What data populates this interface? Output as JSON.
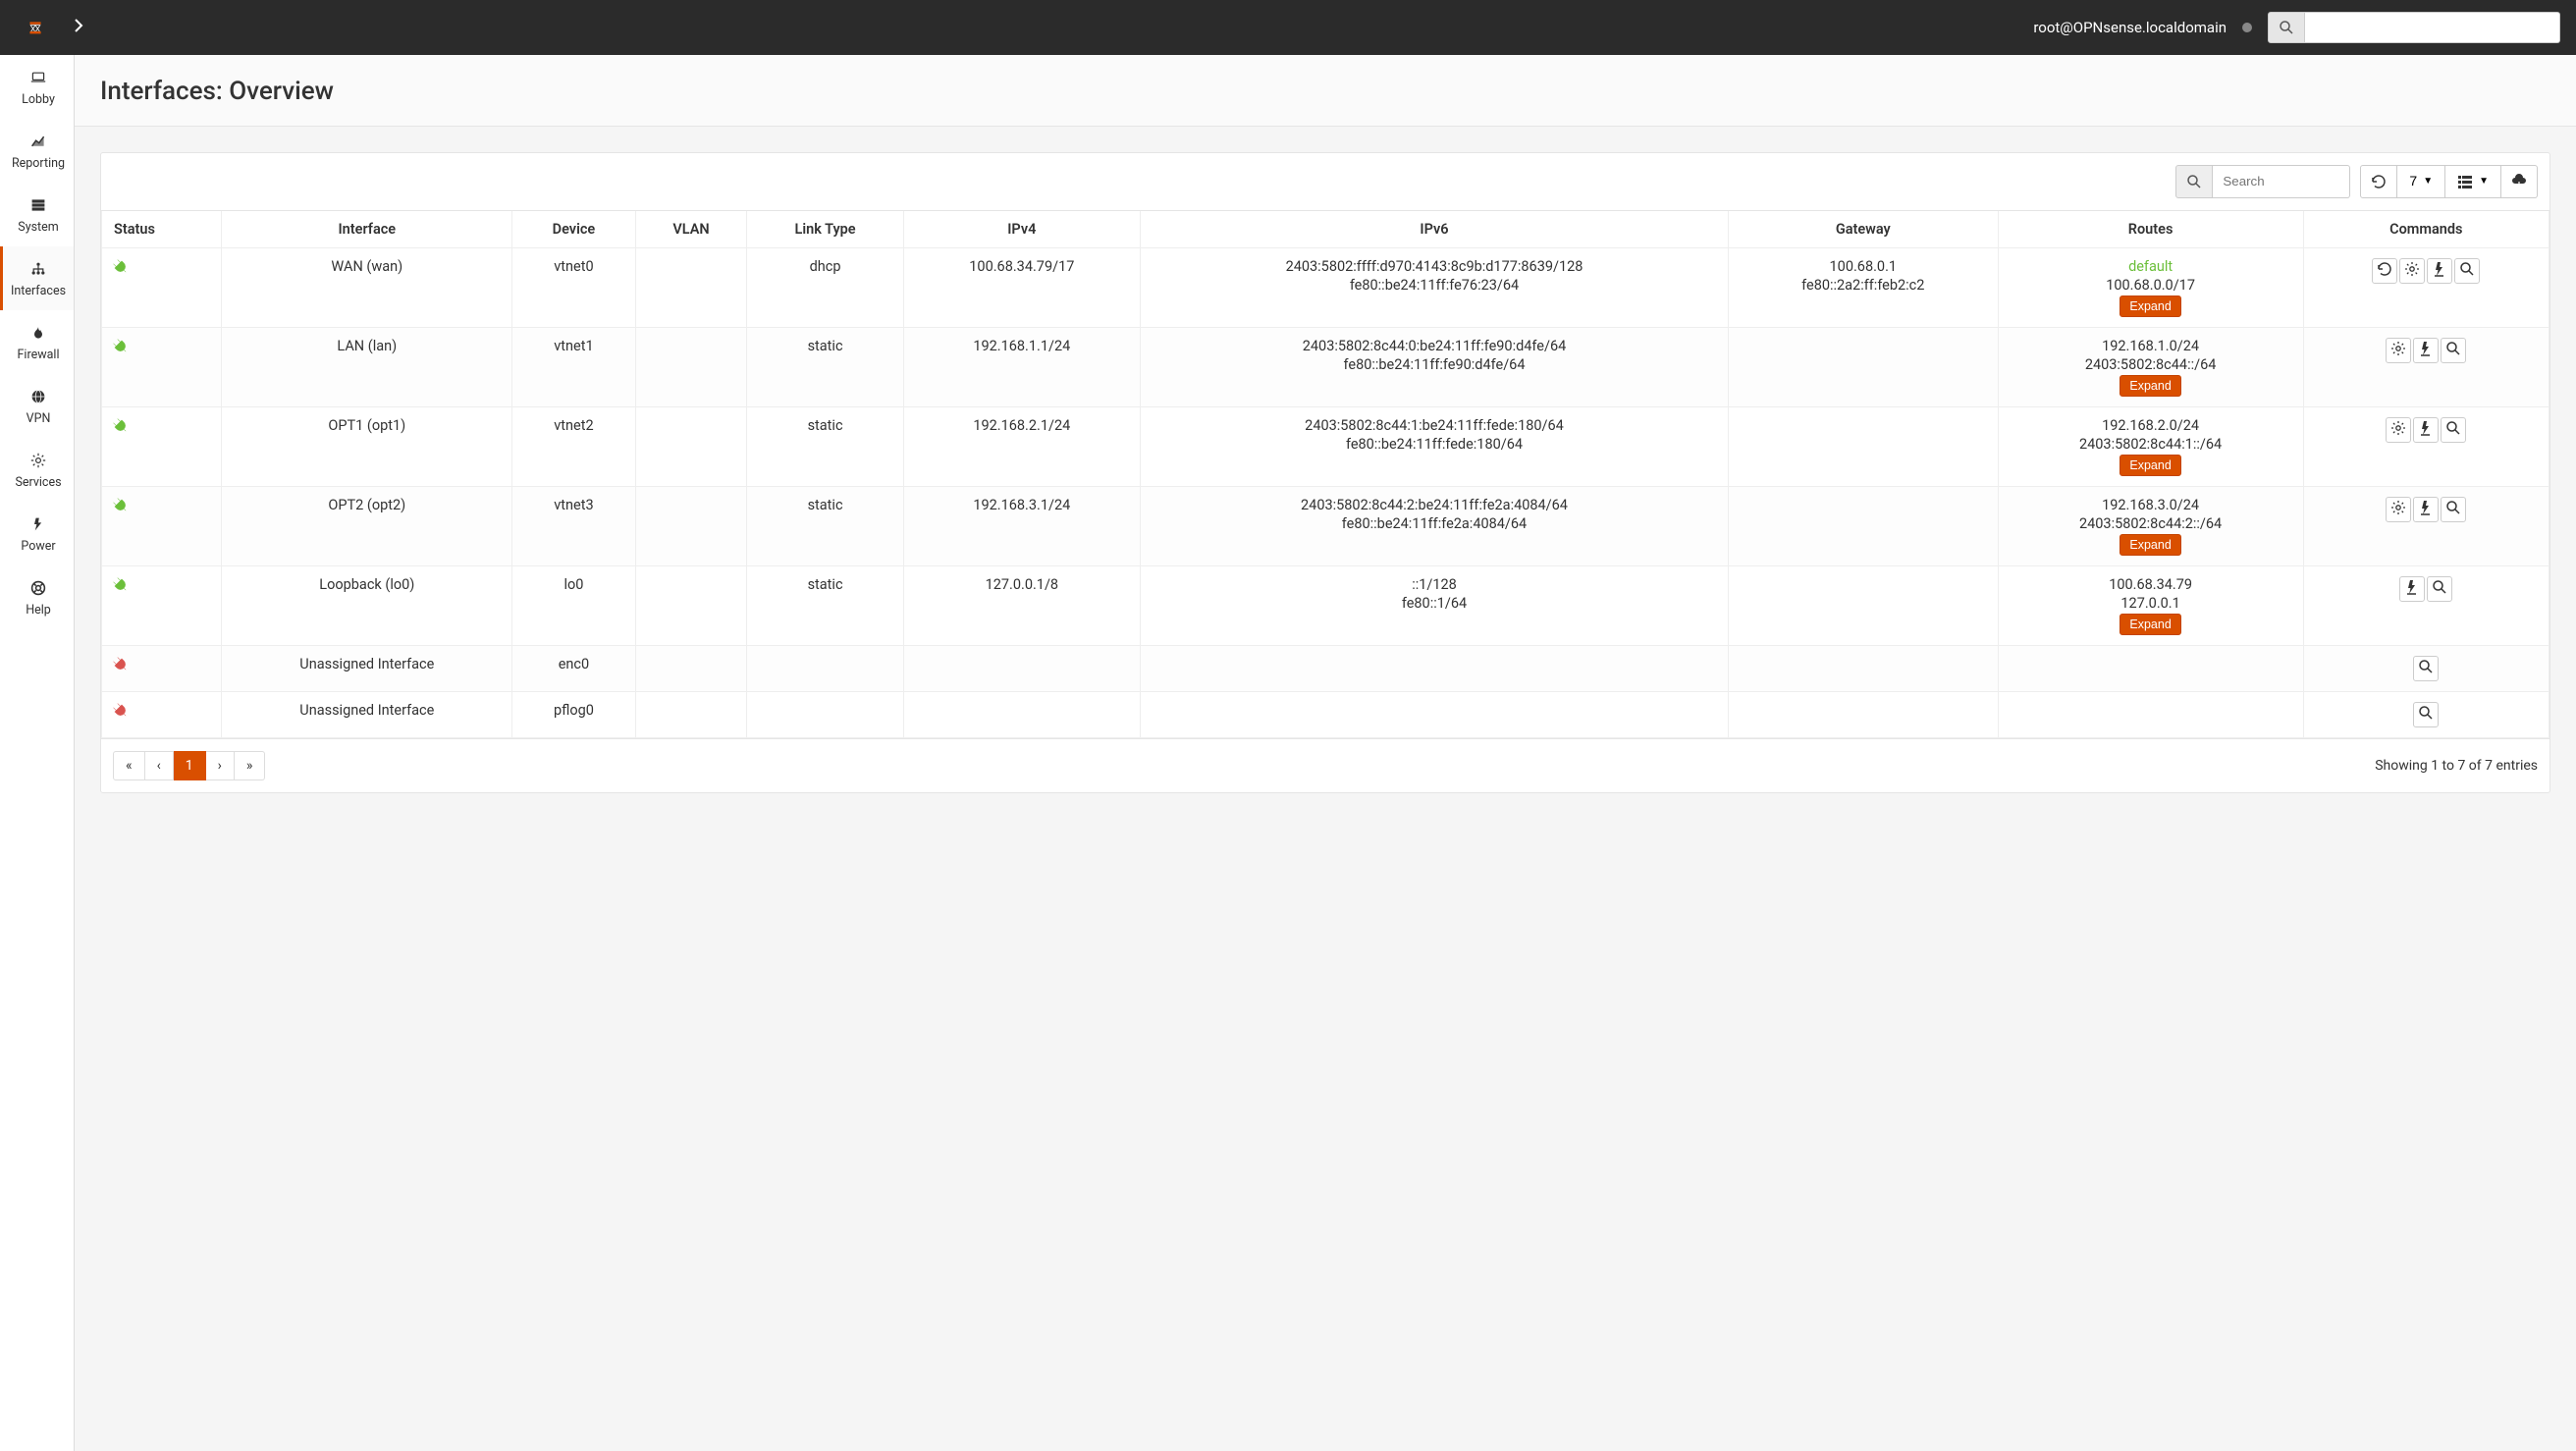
{
  "header": {
    "user": "root@OPNsense.localdomain"
  },
  "sidebar": {
    "items": [
      {
        "label": "Lobby",
        "icon": "laptop"
      },
      {
        "label": "Reporting",
        "icon": "chart"
      },
      {
        "label": "System",
        "icon": "server"
      },
      {
        "label": "Interfaces",
        "icon": "network"
      },
      {
        "label": "Firewall",
        "icon": "fire"
      },
      {
        "label": "VPN",
        "icon": "globe"
      },
      {
        "label": "Services",
        "icon": "gear"
      },
      {
        "label": "Power",
        "icon": "power"
      },
      {
        "label": "Help",
        "icon": "help"
      }
    ],
    "active_index": 3
  },
  "page": {
    "title": "Interfaces: Overview"
  },
  "toolbar": {
    "search_placeholder": "Search",
    "page_size": "7"
  },
  "table": {
    "columns": [
      "Status",
      "Interface",
      "Device",
      "VLAN",
      "Link Type",
      "IPv4",
      "IPv6",
      "Gateway",
      "Routes",
      "Commands"
    ],
    "rows": [
      {
        "status": "up",
        "interface": "WAN (wan)",
        "device": "vtnet0",
        "vlan": "",
        "link_type": "dhcp",
        "ipv4": [
          "100.68.34.79/17"
        ],
        "ipv6": [
          "2403:5802:ffff:d970:4143:8c9b:d177:8639/128",
          "fe80::be24:11ff:fe76:23/64"
        ],
        "gateway": [
          "100.68.0.1",
          "fe80::2a2:ff:feb2:c2"
        ],
        "routes_default": "default",
        "routes": [
          "100.68.0.0/17"
        ],
        "expand": "Expand",
        "commands": [
          "refresh",
          "gear",
          "bolt",
          "search"
        ]
      },
      {
        "status": "up",
        "interface": "LAN (lan)",
        "device": "vtnet1",
        "vlan": "",
        "link_type": "static",
        "ipv4": [
          "192.168.1.1/24"
        ],
        "ipv6": [
          "2403:5802:8c44:0:be24:11ff:fe90:d4fe/64",
          "fe80::be24:11ff:fe90:d4fe/64"
        ],
        "gateway": [],
        "routes": [
          "192.168.1.0/24",
          "2403:5802:8c44::/64"
        ],
        "expand": "Expand",
        "commands": [
          "gear",
          "bolt",
          "search"
        ]
      },
      {
        "status": "up",
        "interface": "OPT1 (opt1)",
        "device": "vtnet2",
        "vlan": "",
        "link_type": "static",
        "ipv4": [
          "192.168.2.1/24"
        ],
        "ipv6": [
          "2403:5802:8c44:1:be24:11ff:fede:180/64",
          "fe80::be24:11ff:fede:180/64"
        ],
        "gateway": [],
        "routes": [
          "192.168.2.0/24",
          "2403:5802:8c44:1::/64"
        ],
        "expand": "Expand",
        "commands": [
          "gear",
          "bolt",
          "search"
        ]
      },
      {
        "status": "up",
        "interface": "OPT2 (opt2)",
        "device": "vtnet3",
        "vlan": "",
        "link_type": "static",
        "ipv4": [
          "192.168.3.1/24"
        ],
        "ipv6": [
          "2403:5802:8c44:2:be24:11ff:fe2a:4084/64",
          "fe80::be24:11ff:fe2a:4084/64"
        ],
        "gateway": [],
        "routes": [
          "192.168.3.0/24",
          "2403:5802:8c44:2::/64"
        ],
        "expand": "Expand",
        "commands": [
          "gear",
          "bolt",
          "search"
        ]
      },
      {
        "status": "up",
        "interface": "Loopback (lo0)",
        "device": "lo0",
        "vlan": "",
        "link_type": "static",
        "ipv4": [
          "127.0.0.1/8"
        ],
        "ipv6": [
          "::1/128",
          "fe80::1/64"
        ],
        "gateway": [],
        "routes": [
          "100.68.34.79",
          "127.0.0.1"
        ],
        "expand": "Expand",
        "commands": [
          "bolt",
          "search"
        ]
      },
      {
        "status": "down",
        "interface": "Unassigned Interface",
        "device": "enc0",
        "vlan": "",
        "link_type": "",
        "ipv4": [],
        "ipv6": [],
        "gateway": [],
        "routes": [],
        "expand": "",
        "commands": [
          "search"
        ]
      },
      {
        "status": "down",
        "interface": "Unassigned Interface",
        "device": "pflog0",
        "vlan": "",
        "link_type": "",
        "ipv4": [],
        "ipv6": [],
        "gateway": [],
        "routes": [],
        "expand": "",
        "commands": [
          "search"
        ]
      }
    ]
  },
  "pagination": {
    "pages": [
      "«",
      "‹",
      "1",
      "›",
      "»"
    ],
    "active_index": 2,
    "info": "Showing 1 to 7 of 7 entries"
  }
}
